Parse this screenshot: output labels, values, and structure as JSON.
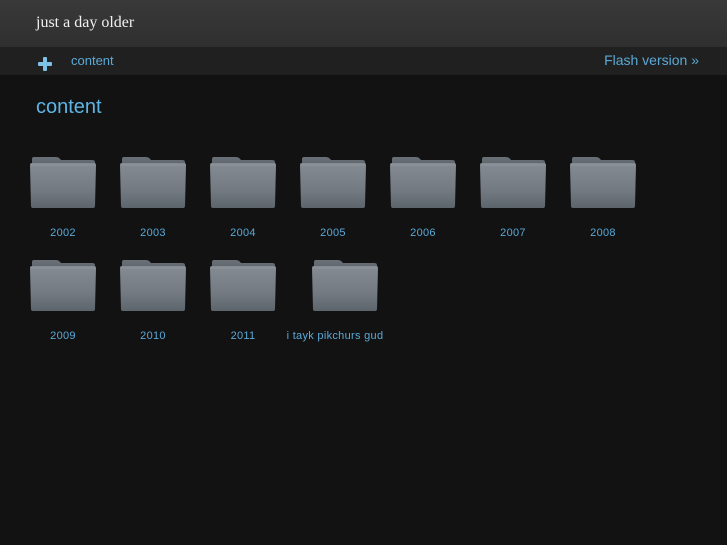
{
  "header": {
    "site_title": "just a day older"
  },
  "nav": {
    "breadcrumb_label": "content",
    "flash_link": "Flash version »"
  },
  "page": {
    "title": "content"
  },
  "folders": [
    {
      "label": "2002"
    },
    {
      "label": "2003"
    },
    {
      "label": "2004"
    },
    {
      "label": "2005"
    },
    {
      "label": "2006"
    },
    {
      "label": "2007"
    },
    {
      "label": "2008"
    },
    {
      "label": "2009"
    },
    {
      "label": "2010"
    },
    {
      "label": "2011"
    },
    {
      "label": "i tayk pikchurs gud"
    }
  ],
  "colors": {
    "accent": "#5aa9d6",
    "background": "#121213",
    "folder": "#7a8087"
  }
}
